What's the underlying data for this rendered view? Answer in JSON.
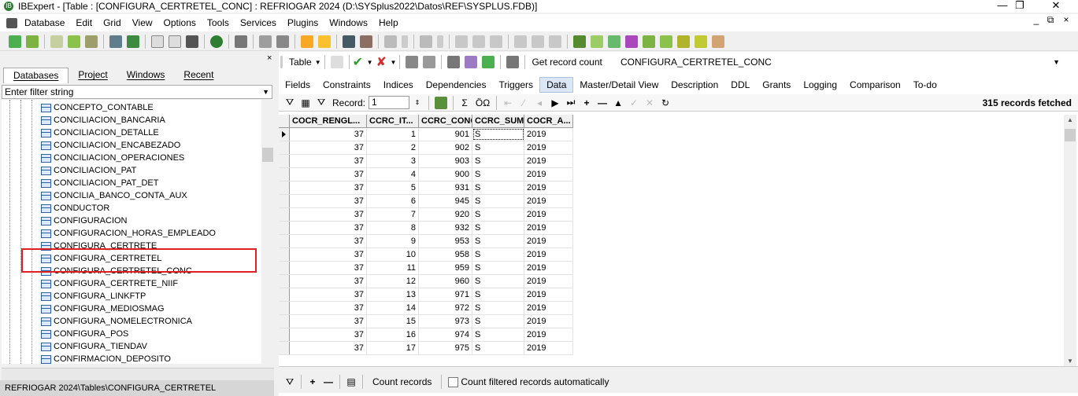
{
  "window": {
    "title": "IBExpert - [Table : [CONFIGURA_CERTRETEL_CONC] : REFRIOGAR 2024 (D:\\SYSplus2022\\Datos\\REF\\SYSPLUS.FDB)]",
    "min": "—",
    "max": "❐",
    "close": "✕"
  },
  "menu": [
    "Database",
    "Edit",
    "Grid",
    "View",
    "Options",
    "Tools",
    "Services",
    "Plugins",
    "Windows",
    "Help"
  ],
  "mdi": {
    "min": "_",
    "restore": "⧉",
    "close": "×"
  },
  "left_panel": {
    "close": "×",
    "tabs": [
      "Databases",
      "Project",
      "Windows",
      "Recent"
    ],
    "filter_placeholder": "Enter filter string",
    "tree_items": [
      "CONCEPTO_CONTABLE",
      "CONCILIACION_BANCARIA",
      "CONCILIACION_DETALLE",
      "CONCILIACION_ENCABEZADO",
      "CONCILIACION_OPERACIONES",
      "CONCILIACION_PAT",
      "CONCILIACION_PAT_DET",
      "CONCILIA_BANCO_CONTA_AUX",
      "CONDUCTOR",
      "CONFIGURACION",
      "CONFIGURACION_HORAS_EMPLEADO",
      "CONFIGURA_CERTRETE",
      "CONFIGURA_CERTRETEL",
      "CONFIGURA_CERTRETEL_CONC",
      "CONFIGURA_CERTRETE_NIIF",
      "CONFIGURA_LINKFTP",
      "CONFIGURA_MEDIOSMAG",
      "CONFIGURA_NOMELECTRONICA",
      "CONFIGURA_POS",
      "CONFIGURA_TIENDAV",
      "CONFIRMACION_DEPOSITO"
    ],
    "status": "REFRIOGAR 2024\\Tables\\CONFIGURA_CERTRETEL"
  },
  "right_panel": {
    "table_label": "Table",
    "get_record_count": "Get record count",
    "table_name": "CONFIGURA_CERTRETEL_CONC",
    "tabs": [
      "Fields",
      "Constraints",
      "Indices",
      "Dependencies",
      "Triggers",
      "Data",
      "Master/Detail View",
      "Description",
      "DDL",
      "Grants",
      "Logging",
      "Comparison",
      "To-do"
    ],
    "active_tab": "Data",
    "record_label": "Record:",
    "record_value": "1",
    "records_fetched": "315 records fetched",
    "sum_label": "Σ",
    "oq_label": "ÖΩ",
    "columns": [
      "COCR_RENGL...",
      "CCRC_IT...",
      "CCRC_CONC",
      "CCRC_SUMA",
      "COCR_A..."
    ],
    "rows": [
      [
        "37",
        "1",
        "901",
        "S",
        "2019"
      ],
      [
        "37",
        "2",
        "902",
        "S",
        "2019"
      ],
      [
        "37",
        "3",
        "903",
        "S",
        "2019"
      ],
      [
        "37",
        "4",
        "900",
        "S",
        "2019"
      ],
      [
        "37",
        "5",
        "931",
        "S",
        "2019"
      ],
      [
        "37",
        "6",
        "945",
        "S",
        "2019"
      ],
      [
        "37",
        "7",
        "920",
        "S",
        "2019"
      ],
      [
        "37",
        "8",
        "932",
        "S",
        "2019"
      ],
      [
        "37",
        "9",
        "953",
        "S",
        "2019"
      ],
      [
        "37",
        "10",
        "958",
        "S",
        "2019"
      ],
      [
        "37",
        "11",
        "959",
        "S",
        "2019"
      ],
      [
        "37",
        "12",
        "960",
        "S",
        "2019"
      ],
      [
        "37",
        "13",
        "971",
        "S",
        "2019"
      ],
      [
        "37",
        "14",
        "972",
        "S",
        "2019"
      ],
      [
        "37",
        "15",
        "973",
        "S",
        "2019"
      ],
      [
        "37",
        "16",
        "974",
        "S",
        "2019"
      ],
      [
        "37",
        "17",
        "975",
        "S",
        "2019"
      ]
    ],
    "count_records": "Count records",
    "count_filtered": "Count filtered records automatically"
  },
  "colors": {
    "highlight_box": "#e02020",
    "active_tab_bg": "#dbe7f5"
  }
}
